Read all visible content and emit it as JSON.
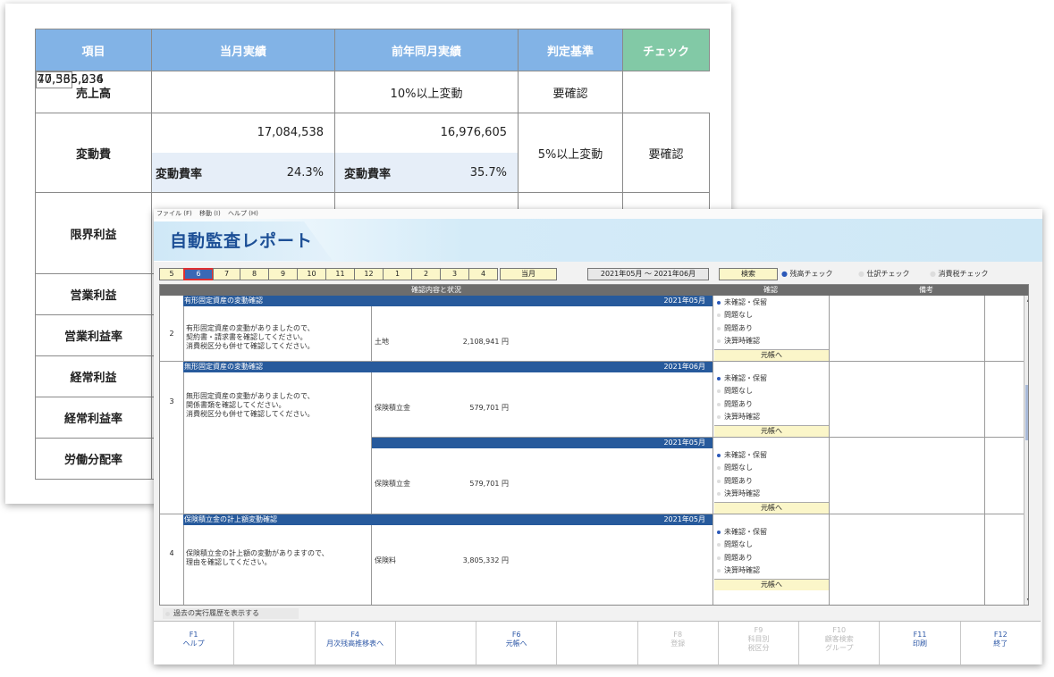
{
  "report": {
    "headers": [
      "項目",
      "当月実績",
      "前年同月実績",
      "判定基準",
      "チェック"
    ],
    "rows": [
      {
        "item": "売上高",
        "current": "70,336,034",
        "prior": "47,565,236",
        "criteria": "10%以上変動",
        "check": "要確認"
      },
      {
        "item": "変動費",
        "current": "17,084,538",
        "prior": "16,976,605",
        "criteria": "5%以上変動",
        "check": "要確認",
        "current_sub_label": "変動費率",
        "current_sub_value": "24.3%",
        "prior_sub_label": "変動費率",
        "prior_sub_value": "35.7%"
      },
      {
        "item": "限界利益"
      },
      {
        "item": "営業利益"
      },
      {
        "item": "営業利益率"
      },
      {
        "item": "経常利益"
      },
      {
        "item": "経常利益率"
      },
      {
        "item": "労働分配率"
      }
    ]
  },
  "app": {
    "menu": [
      "ファイル (F)",
      "移動 (I)",
      "ヘルプ (H)"
    ],
    "title": "自動監査レポート",
    "month_tabs": [
      "5",
      "6",
      "7",
      "8",
      "9",
      "10",
      "11",
      "12",
      "1",
      "2",
      "3",
      "4"
    ],
    "selected_tab": "6",
    "current_month_label": "当月",
    "period": "2021年05月 ～ 2021年06月",
    "search_label": "検索",
    "checks": [
      "残高チェック",
      "仕訳チェック",
      "消費税チェック"
    ],
    "grid_headers": {
      "content": "確認内容と状況",
      "confirm": "確認",
      "note": "備考"
    },
    "options": [
      "未確認・保留",
      "問題なし",
      "問題あり",
      "決算時確認"
    ],
    "ledger_button": "元帳へ",
    "sections": [
      {
        "no": "2",
        "title": "有形固定資産の変動確認",
        "date": "2021年05月",
        "desc": [
          "有形固定資産の変動がありましたので、",
          "契約書・請求書を確認してください。",
          "消費税区分も併せて確認してください。"
        ],
        "account": "土地",
        "amount": "2,108,941 円"
      },
      {
        "no": "3",
        "title": "無形固定資産の変動確認",
        "date": "2021年06月",
        "desc": [
          "無形固定資産の変動がありましたので、",
          "関係書類を確認してください。",
          "消費税区分も併せて確認してください。"
        ],
        "account": "保険積立金",
        "amount": "579,701 円",
        "date2": "2021年05月",
        "account2": "保険積立金",
        "amount2": "579,701 円"
      },
      {
        "no": "4",
        "title": "保険積立金の計上額変動確認",
        "date": "2021年05月",
        "desc": [
          "保険積立金の計上額の変動がありますので、",
          "理由を確認してください。"
        ],
        "account": "保険料",
        "amount": "3,805,332 円"
      }
    ],
    "history_label": "過去の実行履歴を表示する",
    "fkeys": [
      {
        "key": "F1",
        "label": "ヘルプ",
        "label2": ""
      },
      {
        "key": "",
        "label": "",
        "label2": ""
      },
      {
        "key": "F4",
        "label": "月次残高推移表へ",
        "label2": ""
      },
      {
        "key": "",
        "label": "",
        "label2": ""
      },
      {
        "key": "F6",
        "label": "元帳へ",
        "label2": ""
      },
      {
        "key": "",
        "label": "",
        "label2": ""
      },
      {
        "key": "F8",
        "label": "登録",
        "label2": ""
      },
      {
        "key": "F9",
        "label": "科目別",
        "label2": "税区分"
      },
      {
        "key": "F10",
        "label": "顧客検索",
        "label2": "グループ"
      },
      {
        "key": "F11",
        "label": "印刷",
        "label2": ""
      },
      {
        "key": "F12",
        "label": "終了",
        "label2": ""
      }
    ]
  }
}
